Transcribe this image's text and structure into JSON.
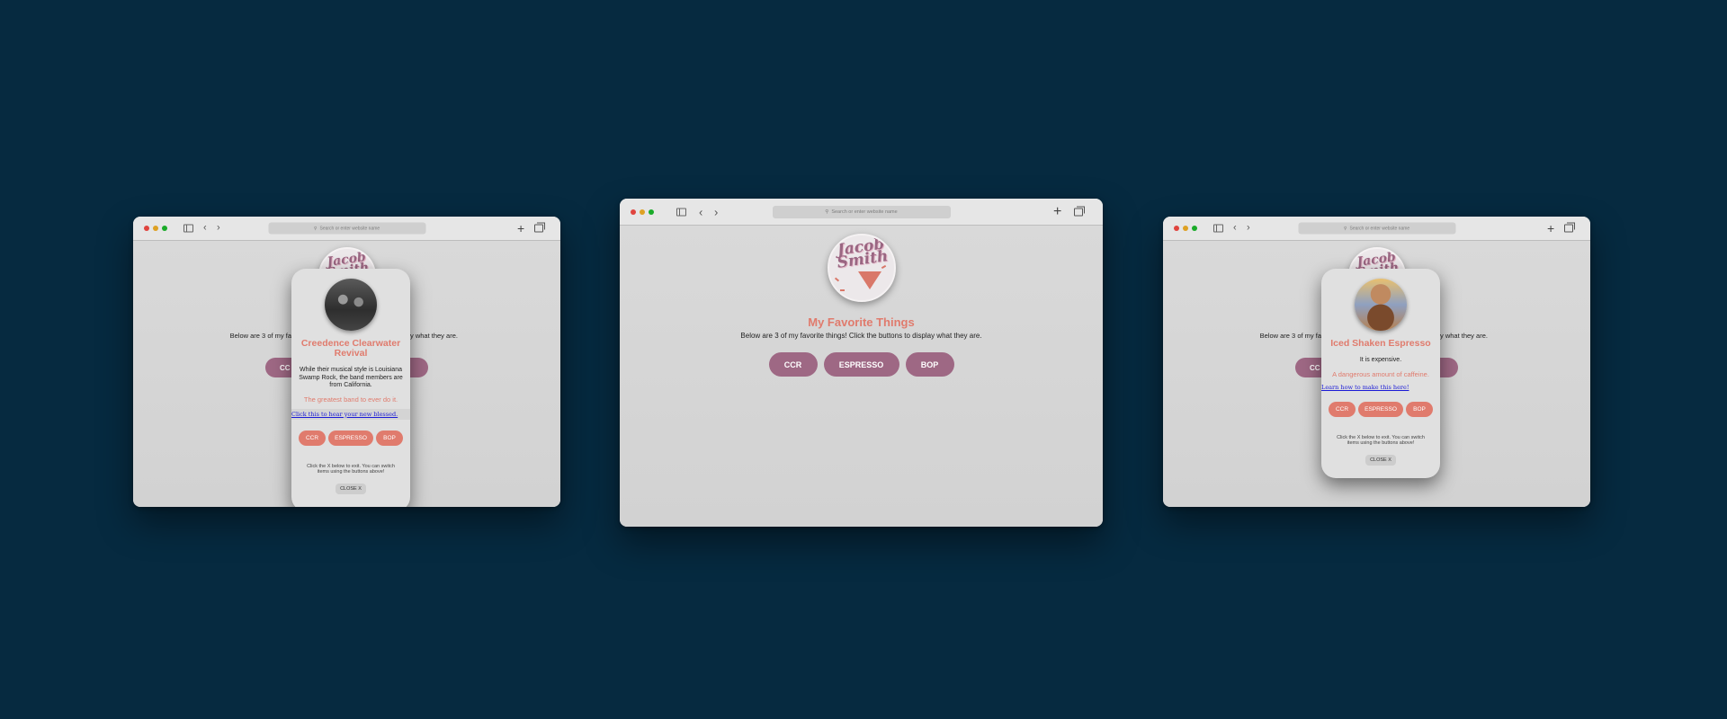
{
  "browser": {
    "address_placeholder": "Search or enter website name",
    "search_icon": "magnifier-icon",
    "new_tab_label": "+"
  },
  "site": {
    "logo_text": [
      "Jacob",
      "Smith"
    ],
    "title": "My Favorite Things",
    "subtitle": "Below are 3 of my favorite things! Click the buttons to display what they are.",
    "subtitle_left_fragment": "Below are 3 of my fa",
    "subtitle_right_fragment": "y what they are.",
    "buttons": {
      "ccr": "CCR",
      "espresso": "ESPRESSO",
      "bop": "BOP"
    },
    "partial_button_label": "CC"
  },
  "modal_ccr": {
    "title": "Creedence Clearwater Revival",
    "description": "While their musical style is Louisiana Swamp Rock, the band members are from California.",
    "accent": "The greatest band to ever do it.",
    "link": "Click this to hear your new blessed.",
    "hint": "Click the X below to exit. You can switch items using the buttons above!",
    "close_label": "CLOSE X"
  },
  "modal_espresso": {
    "title": "Iced Shaken Espresso",
    "description": "It is expensive.",
    "accent": "A dangerous amount of caffeine.",
    "link": "Learn how to make this here!",
    "hint": "Click the X below to exit. You can switch items using the buttons above!",
    "close_label": "CLOSE X"
  },
  "colors": {
    "background": "#062a40",
    "accent_coral": "#e07b6d",
    "button_mauve": "#9e6884"
  }
}
